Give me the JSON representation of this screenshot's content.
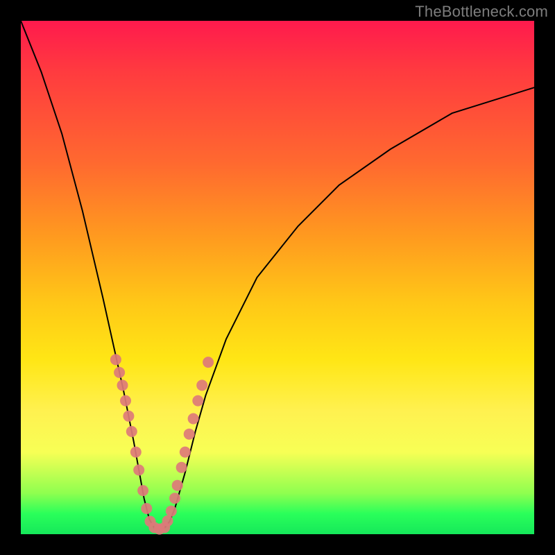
{
  "watermark": "TheBottleneck.com",
  "colors": {
    "frame": "#000000",
    "dot": "#dd7a7a",
    "curve": "#000000"
  },
  "chart_data": {
    "type": "line",
    "title": "",
    "xlabel": "",
    "ylabel": "",
    "xlim": [
      0,
      100
    ],
    "ylim": [
      0,
      100
    ],
    "grid": false,
    "legend": false,
    "note": "Values are percentages of the plot area. x=0 left, x=100 right, y=0 bottom, y=100 top. Curve is a V-shaped bottleneck profile with minimum near x≈27.",
    "series": [
      {
        "name": "bottleneck-curve",
        "x": [
          0,
          4,
          8,
          12,
          16,
          18,
          20,
          22,
          24,
          25,
          26,
          27,
          28,
          29,
          30,
          32,
          34,
          36,
          40,
          46,
          54,
          62,
          72,
          84,
          100
        ],
        "y": [
          100,
          90,
          78,
          63,
          46,
          37,
          28,
          18,
          7,
          3,
          1.2,
          1,
          1.2,
          2.5,
          5,
          12,
          20,
          27,
          38,
          50,
          60,
          68,
          75,
          82,
          87
        ]
      }
    ],
    "scatter_points": {
      "name": "sample-dots",
      "note": "Pink dots clustered on both flanks of the V near the minimum.",
      "x": [
        18.5,
        19.2,
        19.8,
        20.4,
        21.0,
        21.6,
        22.4,
        23.0,
        23.8,
        24.5,
        25.2,
        26.0,
        27.0,
        28.0,
        28.6,
        29.3,
        30.0,
        30.5,
        31.3,
        32.0,
        32.8,
        33.6,
        34.5,
        35.3,
        36.5
      ],
      "y": [
        34.0,
        31.5,
        29.0,
        26.0,
        23.0,
        20.0,
        16.0,
        12.5,
        8.5,
        5.0,
        2.5,
        1.3,
        1.0,
        1.3,
        2.6,
        4.5,
        7.0,
        9.5,
        13.0,
        16.0,
        19.5,
        22.5,
        26.0,
        29.0,
        33.5
      ]
    }
  }
}
